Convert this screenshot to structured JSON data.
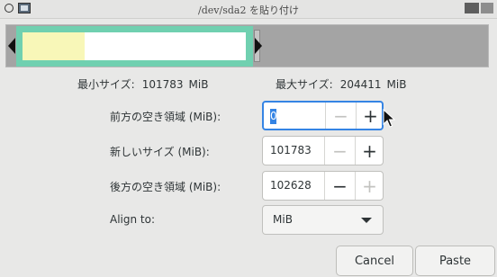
{
  "window": {
    "title": "/dev/sda2 を貼り付け"
  },
  "partition_visual": {
    "colors": {
      "frame": "#70d0b0",
      "used": "#f8f7b8",
      "unused": "#ffffff",
      "unallocated": "#a4a4a4"
    }
  },
  "limits": {
    "min_label": "最小サイズ:",
    "min_value": "101783",
    "max_label": "最大サイズ:",
    "max_value": "204411",
    "unit": "MiB"
  },
  "fields": {
    "free_before": {
      "label": "前方の空き領域 (MiB):",
      "value": "0"
    },
    "new_size": {
      "label": "新しいサイズ (MiB):",
      "value": "101783"
    },
    "free_after": {
      "label": "後方の空き領域 (MiB):",
      "value": "102628"
    },
    "align": {
      "label": "Align to:",
      "value": "MiB"
    }
  },
  "buttons": {
    "cancel": "Cancel",
    "paste": "Paste"
  },
  "icons": {
    "minus": "−",
    "plus": "+"
  }
}
